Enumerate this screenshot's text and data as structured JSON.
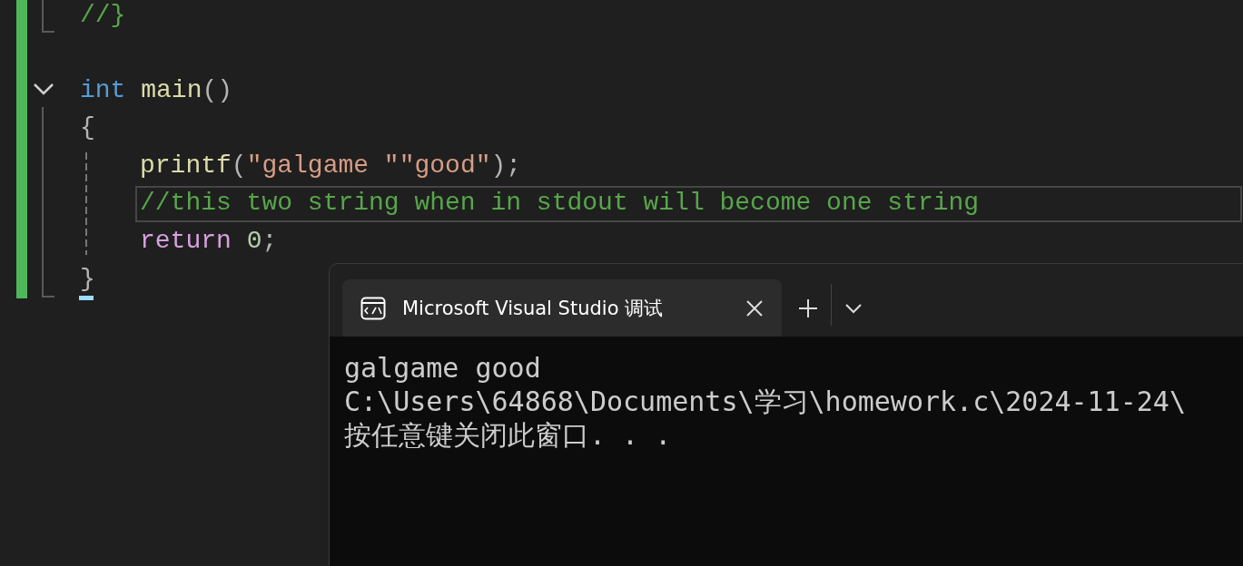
{
  "editor": {
    "lines": [
      {
        "current": false,
        "tokens": [
          {
            "kind": "comment",
            "text": "//}"
          }
        ]
      },
      {
        "kind": "blank"
      },
      {
        "current": false,
        "fold": {
          "expanded": true
        },
        "tokens": [
          {
            "kind": "keyword",
            "text": "int"
          },
          {
            "kind": "function",
            "text": "main"
          },
          {
            "kind": "punct",
            "text": "()"
          }
        ]
      },
      {
        "current": false,
        "tokens": [
          {
            "kind": "punct",
            "text": "{"
          }
        ],
        "children": [
          {
            "current": false,
            "tokens": [
              {
                "kind": "function",
                "text": "printf"
              },
              {
                "kind": "punct",
                "text": "("
              },
              {
                "kind": "string",
                "text": "\"galgame \""
              },
              {
                "kind": "string",
                "text": "\"good\""
              },
              {
                "kind": "punct",
                "text": ");"
              }
            ]
          },
          {
            "current": true,
            "tokens": [
              {
                "kind": "comment",
                "text": "//this two string when in stdout will become one string"
              }
            ]
          },
          {
            "current": false,
            "tokens": [
              {
                "kind": "control",
                "text": "return"
              },
              {
                "kind": "number",
                "text": "0"
              },
              {
                "kind": "punct",
                "text": ";"
              }
            ]
          }
        ]
      },
      {
        "current": false,
        "tokens": [
          {
            "kind": "punct",
            "text": "}"
          }
        ]
      }
    ]
  },
  "terminal": {
    "tabs": [
      {
        "title": "Microsoft Visual Studio 调试",
        "selected": true
      }
    ],
    "output": [
      "galgame good",
      "C:\\Users\\64868\\Documents\\学习\\homework.c\\2024-11-24\\",
      "按任意键关闭此窗口. . ."
    ]
  }
}
